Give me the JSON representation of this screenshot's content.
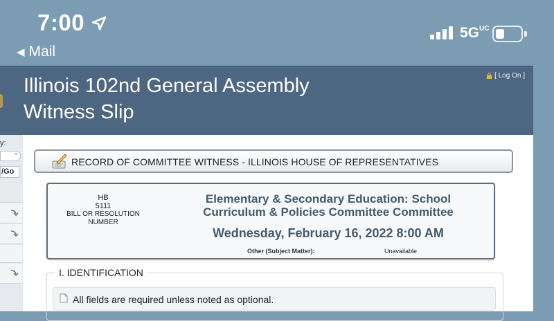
{
  "status_bar": {
    "time": "7:00",
    "back_label": "Mail",
    "network": "5G",
    "network_suffix": "UC"
  },
  "site": {
    "title_line1": "Illinois 102nd General Assembly",
    "title_line2": "Witness Slip",
    "logon_label": "Log On"
  },
  "sidebar": {
    "label": "y:",
    "go_label": "Go"
  },
  "record": {
    "title": "RECORD OF COMMITTEE WITNESS - ILLINOIS HOUSE OF REPRESENTATIVES"
  },
  "bill": {
    "number": "HB 5111",
    "number_label": "BILL OR RESOLUTION NUMBER",
    "committee": "Elementary & Secondary Education: School Curriculum & Policies Committee Committee",
    "datetime": "Wednesday, February 16, 2022 8:00 AM",
    "subject_label": "Other (Subject Matter):",
    "subject_value": "Unavailable"
  },
  "identification": {
    "legend": "I. IDENTIFICATION",
    "notice": "All fields are required unless noted as optional."
  },
  "colors": {
    "status_bg": "#7b9cb3",
    "header_bg": "#4d6682",
    "heading_text": "#445a6c"
  }
}
